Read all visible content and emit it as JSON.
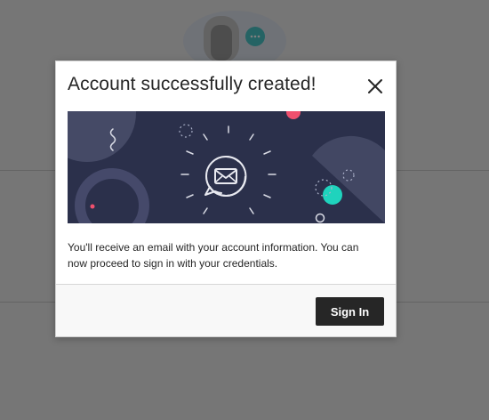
{
  "modal": {
    "title": "Account successfully created!",
    "close_label": "Close",
    "body_text": "You'll receive an email with your account information. You can now proceed to sign in with your credentials.",
    "sign_in_label": "Sign In",
    "close_icon": "close-icon",
    "banner_icon": "envelope-icon"
  },
  "colors": {
    "banner_background": "#2b304b",
    "accent_teal": "#1fd3bd",
    "accent_coral": "#f0506e",
    "button_background": "#262626",
    "button_text": "#ffffff",
    "overlay": "#777777"
  }
}
